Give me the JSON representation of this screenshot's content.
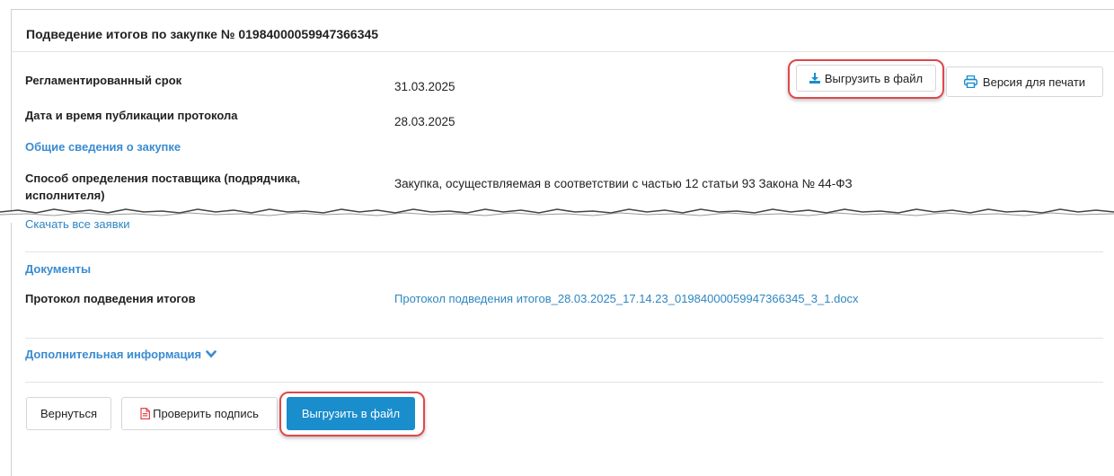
{
  "header": {
    "title": "Подведение итогов по закупке № 01984000059947366345"
  },
  "fields": {
    "deadline_label": "Регламентированный срок",
    "deadline_value": "31.03.2025",
    "published_label": "Дата и время публикации протокола",
    "published_value": "28.03.2025",
    "general_info_link": "Общие сведения о закупке",
    "method_label": "Способ определения поставщика (подрядчика, исполнителя)",
    "method_value": "Закупка, осуществляемая в соответствии с частью 12 статьи 93 Закона № 44-ФЗ",
    "download_all_link": "Скачать все заявки"
  },
  "toolbar": {
    "export_label": "Выгрузить в файл",
    "print_label": "Версия для печати"
  },
  "documents": {
    "section_title": "Документы",
    "protocol_label": "Протокол подведения итогов",
    "protocol_file": "Протокол подведения итогов_28.03.2025_17.14.23_01984000059947366345_3_1.docx"
  },
  "additional": {
    "label": "Дополнительная информация"
  },
  "footer": {
    "back_label": "Вернуться",
    "verify_label": "Проверить подпись",
    "export_label": "Выгрузить в файл"
  },
  "colors": {
    "link": "#2e86c1",
    "primary": "#1a8dcc",
    "highlight": "#e0474c",
    "pdf_icon": "#e0474c"
  },
  "icons": {
    "export": "download-icon",
    "print": "printer-icon",
    "verify": "pdf-file-icon",
    "expand": "chevron-down-icon"
  }
}
